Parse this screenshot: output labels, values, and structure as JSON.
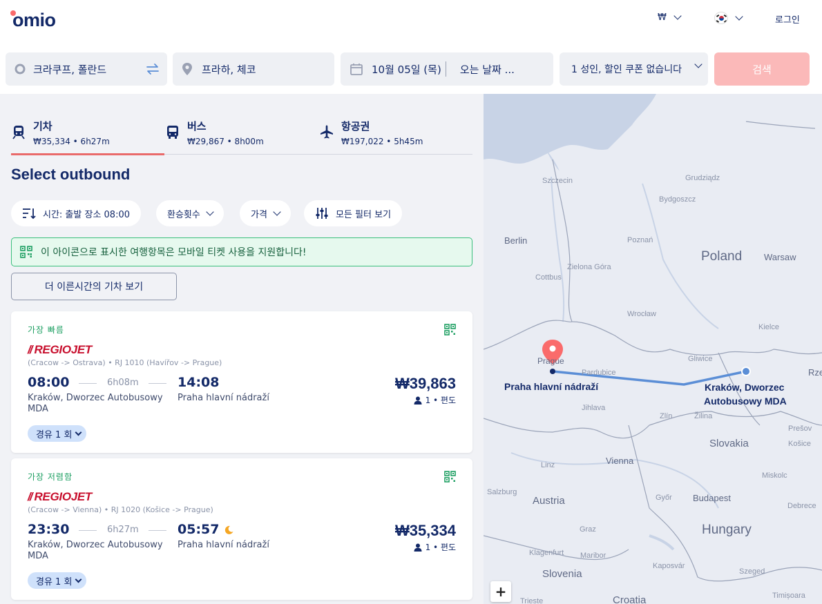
{
  "nav": {
    "logo": "omio",
    "currency": "₩",
    "login": "로그인"
  },
  "search": {
    "from": "크라쿠프, 폴란드",
    "to": "프라하, 체코",
    "depart_date": "10월 05일 (목)",
    "return_placeholder": "오는 날짜 ...",
    "passengers": "1 성인, 할인 쿠폰 없습니다",
    "button": "검색"
  },
  "tabs": [
    {
      "label": "기차",
      "info": "₩35,334 • 6h27m",
      "icon": "train-icon"
    },
    {
      "label": "버스",
      "info": "₩29,867 • 8h00m",
      "icon": "bus-icon"
    },
    {
      "label": "항공권",
      "info": "₩197,022 • 5h45m",
      "icon": "plane-icon"
    }
  ],
  "page_title": "Select outbound",
  "filters": {
    "sort": "시간: 출발 장소 08:00",
    "transfers": "환승횟수",
    "price": "가격",
    "all": "모든 필터 보기"
  },
  "notice": "이 아이콘으로 표시한 여행항목은 모바일 티켓 사용을 지원합니다!",
  "earlier_button": "더 이른시간의 기차 보기",
  "results": [
    {
      "badge": "가장 빠름",
      "operator": "REGIOJET",
      "route": "(Cracow -> Ostrava) • RJ 1010 (Havířov -> Prague)",
      "dep_time": "08:00",
      "duration": "6h08m",
      "arr_time": "14:08",
      "from": "Kraków, Dworzec Autobusowy MDA",
      "to": "Praha hlavní nádraží",
      "price": "₩39,863",
      "pax": "1 • 편도",
      "stops": "경유 1 회",
      "overnight": false
    },
    {
      "badge": "가장 저렴함",
      "operator": "REGIOJET",
      "route": "(Cracow -> Vienna) • RJ 1020 (Košice -> Prague)",
      "dep_time": "23:30",
      "duration": "6h27m",
      "arr_time": "05:57",
      "from": "Kraków, Dworzec Autobusowy MDA",
      "to": "Praha hlavní nádraží",
      "price": "₩35,334",
      "pax": "1 • 편도",
      "stops": "경유 1 회",
      "overnight": true
    }
  ],
  "map": {
    "pin_city": "Prague",
    "origin_label": "Kraków, Dworzec Autobusowy MDA",
    "destination_label": "Praha hlavní nádraží",
    "zoom_in": "+",
    "labels": {
      "szczecin": "Szczecin",
      "grudziadz": "Grudziądz",
      "bydgoszcz": "Bydgoszcz",
      "berlin": "Berlin",
      "poznan": "Poznań",
      "poland": "Poland",
      "warsaw": "Warsaw",
      "zielona_gora": "Zielona Góra",
      "cottbus": "Cottbus",
      "wroclaw": "Wrocław",
      "kielce": "Kielce",
      "pardubice": "Pardubice",
      "gliwice": "Gliwice",
      "rzeszow": "Rze",
      "jihlava": "Jihlava",
      "zlin": "Zlín",
      "zilina": "Žilina",
      "presov": "Prešov",
      "kosice": "Košice",
      "slovakia": "Slovakia",
      "linz": "Linz",
      "vienna": "Vienna",
      "miskolc": "Miskolc",
      "salzburg": "Salzburg",
      "austria": "Austria",
      "gyor": "Győr",
      "budapest": "Budapest",
      "debrecen": "Debrece",
      "graz": "Graz",
      "hungary": "Hungary",
      "klagenfurt": "Klagenfurt",
      "maribor": "Maribor",
      "kaposvar": "Kaposvár",
      "szeged": "Szeged",
      "slovenia": "Slovenia",
      "croatia": "Croatia",
      "trieste": "Trieste",
      "timisoara": "Timișoara"
    }
  },
  "colors": {
    "brand_navy": "#132968",
    "brand_coral": "#fa6b6b",
    "search_disabled": "#fbb9b9",
    "success_green": "#1d9f62",
    "route_blue": "#5b8ed6",
    "regiojet_red": "#c8102e"
  }
}
